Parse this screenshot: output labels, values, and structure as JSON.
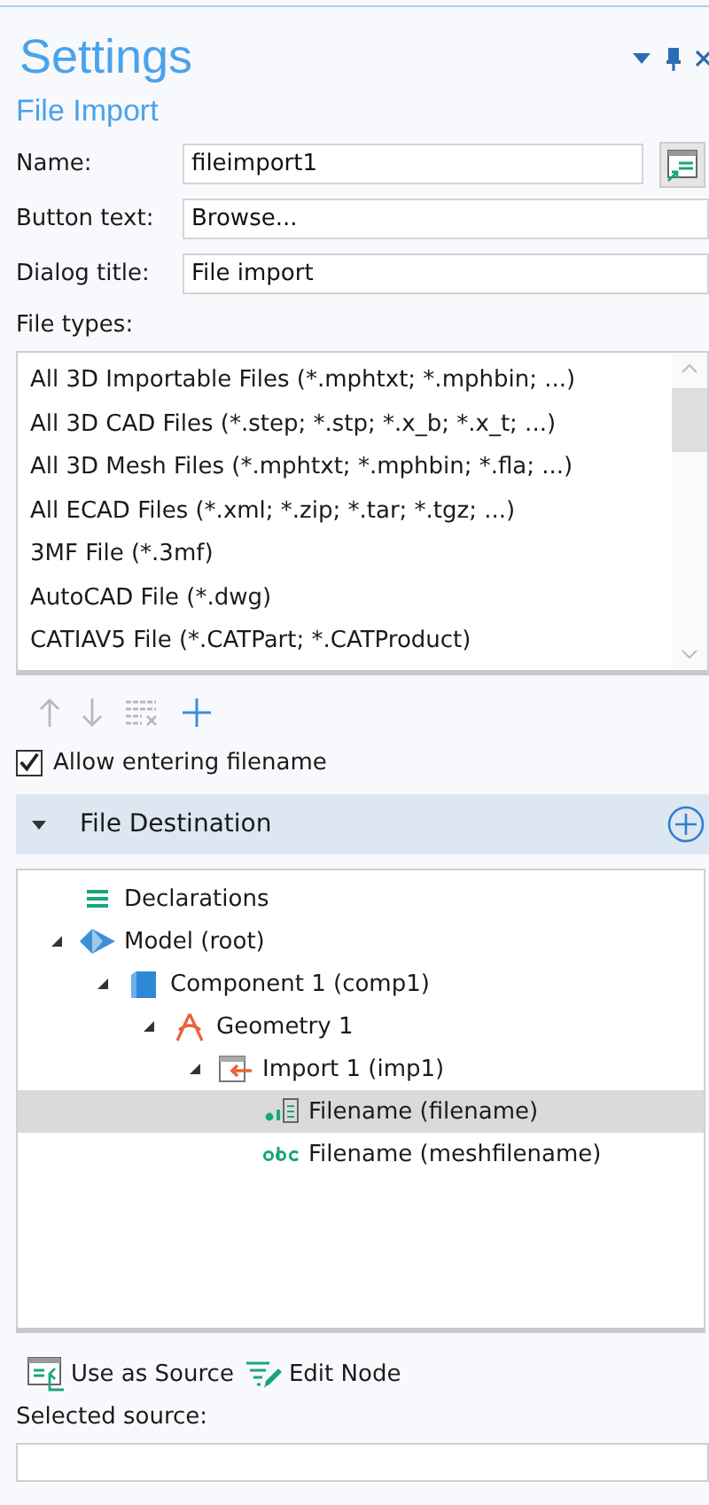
{
  "header": {
    "title": "Settings",
    "subtitle": "File Import"
  },
  "fields": [
    {
      "label": "Name:",
      "value": "fileimport1",
      "kind": "with-button"
    },
    {
      "label": "Button text:",
      "value": "Browse...",
      "kind": "plain"
    },
    {
      "label": "Dialog title:",
      "value": "File import",
      "kind": "plain"
    }
  ],
  "file_types": {
    "label": "File types:",
    "items": [
      {
        "label": "All 3D Importable Files (*.mphtxt; *.mphbin; ...)",
        "selected": false
      },
      {
        "label": "All 3D CAD Files (*.step; *.stp; *.x_b; *.x_t; ...)",
        "selected": false
      },
      {
        "label": "All 3D Mesh Files (*.mphtxt; *.mphbin; *.fla; ...)",
        "selected": false
      },
      {
        "label": "All ECAD Files (*.xml; *.zip; *.tar; *.tgz; ...)",
        "selected": false
      },
      {
        "label": "3MF File (*.3mf)",
        "selected": false
      },
      {
        "label": "AutoCAD File (*.dwg)",
        "selected": false
      },
      {
        "label": "CATIAV5 File (*.CATPart; *.CATProduct)",
        "selected": false
      }
    ]
  },
  "list_toolbar": [
    {
      "kind": "up",
      "disabled": true
    },
    {
      "kind": "down",
      "disabled": true
    },
    {
      "kind": "clear",
      "disabled": true
    },
    {
      "kind": "add",
      "disabled": false
    }
  ],
  "allow_entering_filename": {
    "label": "Allow entering filename",
    "checked": true
  },
  "section": {
    "title": "File Destination",
    "expanded": true
  },
  "tree": [
    {
      "label": "Declarations",
      "kind": "declarations",
      "selected": false
    },
    {
      "label": "Model (root)",
      "kind": "model",
      "selected": false,
      "expanded": true,
      "children": [
        {
          "label": "Component 1 (comp1)",
          "kind": "component",
          "selected": false,
          "expanded": true,
          "children": [
            {
              "label": "Geometry 1",
              "kind": "geometry",
              "selected": false,
              "expanded": true,
              "children": [
                {
                  "label": "Import 1 (imp1)",
                  "kind": "import",
                  "selected": false,
                  "expanded": true,
                  "children": [
                    {
                      "label": "Filename (filename)",
                      "kind": "filename-field",
                      "selected": true
                    },
                    {
                      "label": "Filename (meshfilename)",
                      "kind": "text-value",
                      "selected": false
                    }
                  ]
                }
              ]
            }
          ]
        }
      ]
    }
  ],
  "actions": [
    {
      "label": "Use as Source",
      "kind": "use-source"
    },
    {
      "label": "Edit Node",
      "kind": "edit"
    }
  ],
  "selected_source": {
    "label": "Selected source:"
  }
}
